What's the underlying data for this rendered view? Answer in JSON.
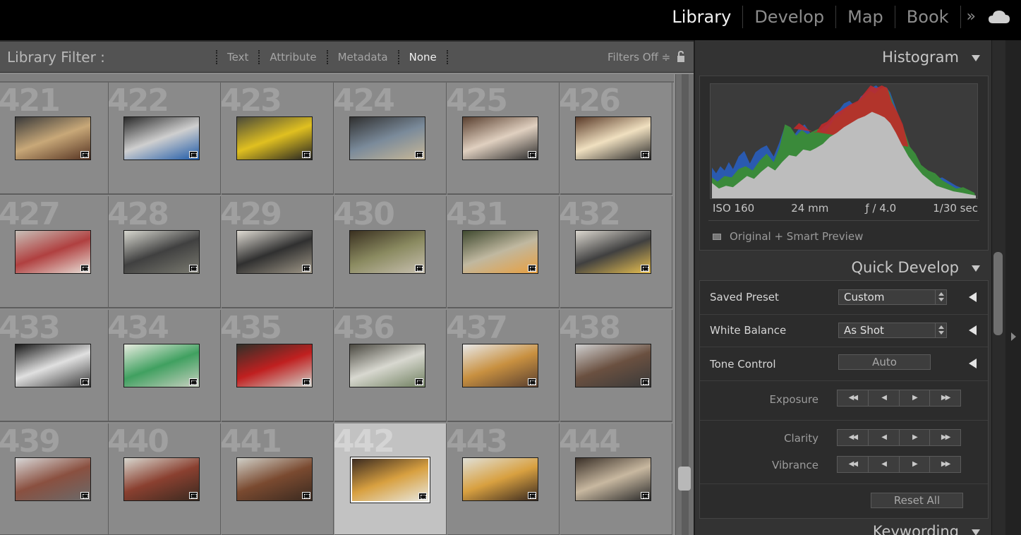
{
  "modules": {
    "items": [
      "Library",
      "Develop",
      "Map",
      "Book"
    ],
    "active": "Library",
    "more_label": "»"
  },
  "filter_bar": {
    "title": "Library Filter :",
    "tabs": [
      "Text",
      "Attribute",
      "Metadata",
      "None"
    ],
    "selected_tab": "None",
    "filters_status": "Filters Off ≑"
  },
  "grid": {
    "cells": [
      {
        "num": "421"
      },
      {
        "num": "422"
      },
      {
        "num": "423"
      },
      {
        "num": "424"
      },
      {
        "num": "425"
      },
      {
        "num": "426"
      },
      {
        "num": "427"
      },
      {
        "num": "428"
      },
      {
        "num": "429"
      },
      {
        "num": "430"
      },
      {
        "num": "431"
      },
      {
        "num": "432"
      },
      {
        "num": "433"
      },
      {
        "num": "434"
      },
      {
        "num": "435"
      },
      {
        "num": "436"
      },
      {
        "num": "437"
      },
      {
        "num": "438"
      },
      {
        "num": "439"
      },
      {
        "num": "440"
      },
      {
        "num": "441"
      },
      {
        "num": "442"
      },
      {
        "num": "443"
      },
      {
        "num": "444"
      }
    ],
    "selected": "442"
  },
  "histogram": {
    "title": "Histogram",
    "iso": "ISO 160",
    "focal": "24 mm",
    "aperture": "ƒ / 4.0",
    "shutter": "1/30 sec",
    "preview_status": "Original + Smart Preview"
  },
  "quick_develop": {
    "title": "Quick Develop",
    "saved_preset_label": "Saved Preset",
    "saved_preset_value": "Custom",
    "white_balance_label": "White Balance",
    "white_balance_value": "As Shot",
    "tone_control_label": "Tone Control",
    "auto_label": "Auto",
    "exposure_label": "Exposure",
    "clarity_label": "Clarity",
    "vibrance_label": "Vibrance",
    "reset_label": "Reset All"
  },
  "keywording": {
    "title": "Keywording"
  },
  "colors": {
    "accent": "#f2f2f2",
    "panel_bg": "#333333",
    "grid_bg": "#8a8a8a",
    "selected_cell": "#c2c2c2"
  }
}
